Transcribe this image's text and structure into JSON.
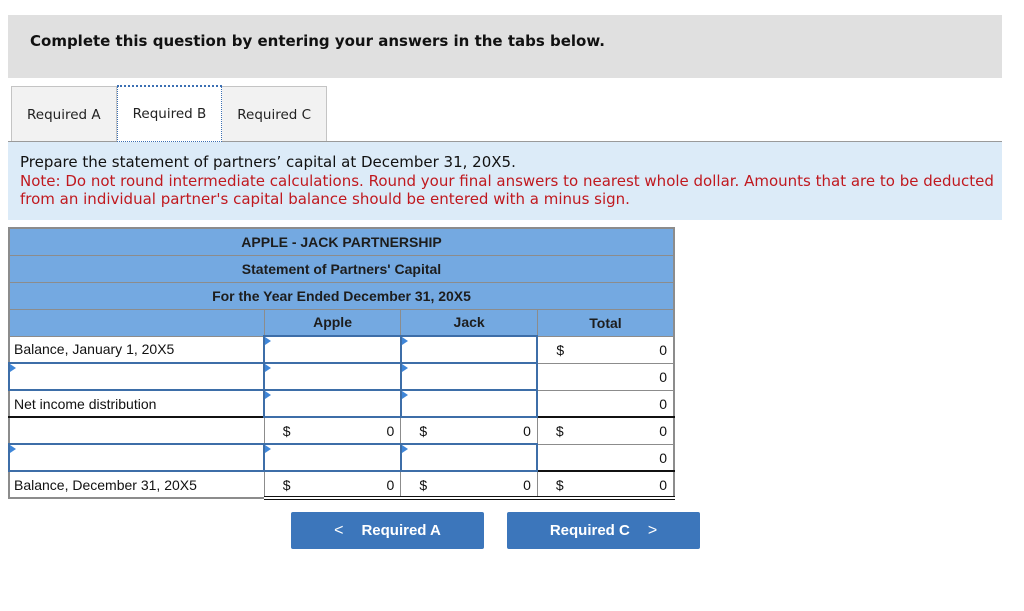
{
  "header": {
    "instruction": "Complete this question by entering your answers in the tabs below."
  },
  "tabs": [
    {
      "label": "Required A",
      "active": false
    },
    {
      "label": "Required B",
      "active": true
    },
    {
      "label": "Required C",
      "active": false
    }
  ],
  "prompt": {
    "question": "Prepare the statement of partners’ capital at December 31, 20X5.",
    "note": "Note: Do not round intermediate calculations. Round your final answers to nearest whole dollar. Amounts that are to be deducted from an individual partner's capital balance should be entered with a minus sign."
  },
  "statement": {
    "title1": "APPLE - JACK PARTNERSHIP",
    "title2": "Statement of Partners' Capital",
    "title3": "For the Year Ended December 31, 20X5",
    "columns": [
      "",
      "Apple",
      "Jack",
      "Total"
    ],
    "currency_symbol": "$",
    "rows": [
      {
        "label": "Balance, January 1, 20X5",
        "label_editable": false,
        "apple": "",
        "jack": "",
        "total": "0",
        "apple_editable": true,
        "jack_editable": true
      },
      {
        "label": "",
        "label_editable": true,
        "apple": "",
        "jack": "",
        "total": "0",
        "apple_editable": true,
        "jack_editable": true
      },
      {
        "label": "Net income distribution",
        "label_editable": false,
        "apple": "",
        "jack": "",
        "total": "0",
        "apple_editable": true,
        "jack_editable": true
      },
      {
        "label": "",
        "label_editable": false,
        "apple": "0",
        "jack": "0",
        "total": "0",
        "apple_editable": false,
        "jack_editable": false
      },
      {
        "label": "",
        "label_editable": true,
        "apple": "",
        "jack": "",
        "total": "0",
        "apple_editable": true,
        "jack_editable": true
      },
      {
        "label": "Balance, December 31, 20X5",
        "label_editable": false,
        "apple": "0",
        "jack": "0",
        "total": "0",
        "apple_editable": false,
        "jack_editable": false
      }
    ]
  },
  "navigation": {
    "prev_label": "Required A",
    "next_label": "Required C",
    "prev_icon": "chevron-left-icon",
    "next_icon": "chevron-right-icon",
    "prev_glyph": "<",
    "next_glyph": ">"
  },
  "colors": {
    "header_bg": "#e0e0e0",
    "panel_bg": "#dcebf8",
    "note_red": "#c0191f",
    "table_header_blue": "#74a9e1",
    "button_blue": "#3c76bb"
  }
}
